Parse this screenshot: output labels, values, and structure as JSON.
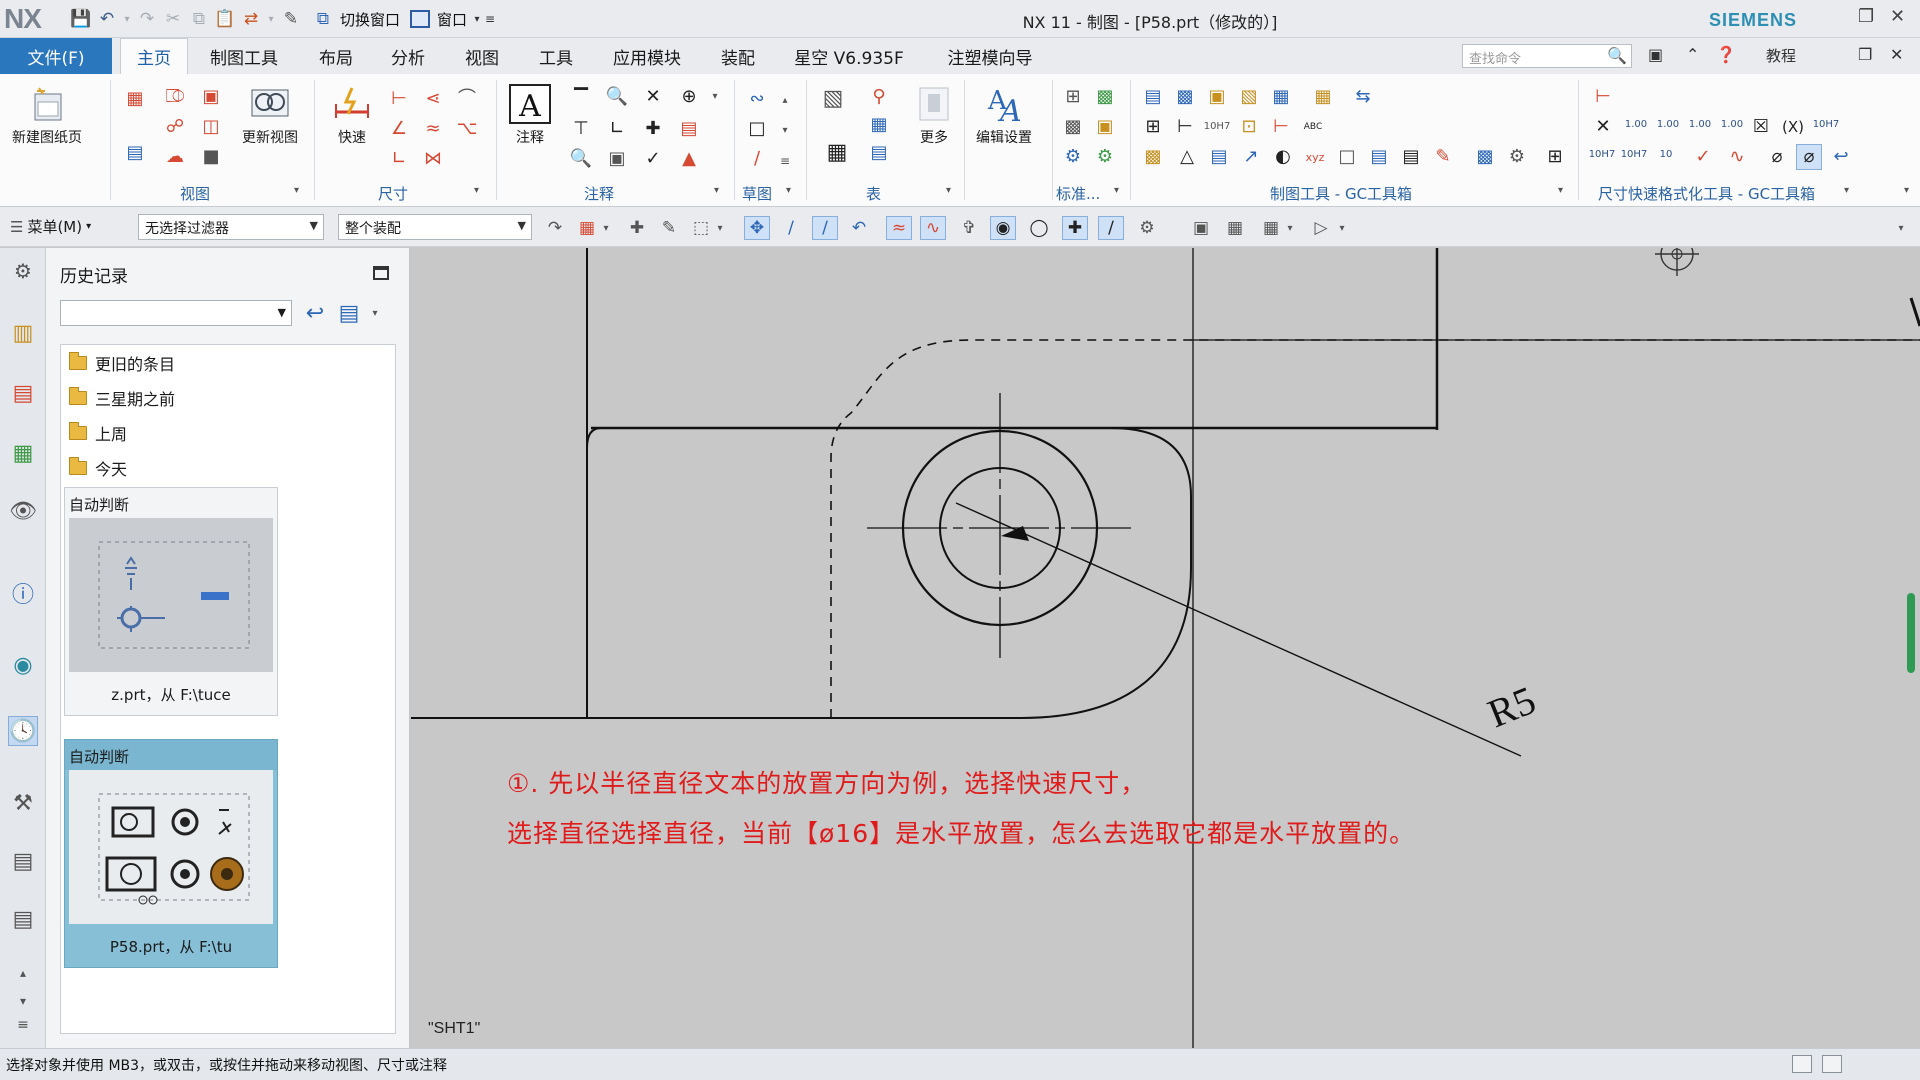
{
  "window": {
    "app_logo": "NX",
    "title": "NX 11 - 制图 - [P58.prt（修改的）]",
    "brand": "SIEMENS",
    "quick_access": {
      "switch_window": "切换窗口",
      "window_menu": "窗口"
    }
  },
  "ribbon_tabs": {
    "file": "文件(F)",
    "tabs": [
      "主页",
      "制图工具",
      "布局",
      "分析",
      "视图",
      "工具",
      "应用模块",
      "装配",
      "星空 V6.935F",
      "注塑模向导"
    ],
    "active_tab": "主页",
    "search_placeholder": "查找命令",
    "tutorial": "教程"
  },
  "ribbon": {
    "new_sheet": "新建图纸页",
    "update_view": "更新视图",
    "rapid": "快速",
    "note": "注释",
    "more": "更多",
    "edit_settings": "编辑设置",
    "groups": {
      "view": "视图",
      "dimension": "尺寸",
      "annotation": "注释",
      "sketch": "草图",
      "table": "表",
      "standard": "标准...",
      "drafting_tools": "制图工具 - GC工具箱",
      "dim_format": "尺寸快速格式化工具 - GC工具箱"
    },
    "tolerance_icons": [
      "1.00",
      "1.00",
      "1.00",
      "1.00",
      "10H7",
      "10H7",
      "10H7",
      "10"
    ]
  },
  "selection_bar": {
    "menu": "菜单(M)",
    "filter": "无选择过滤器",
    "scope": "整个装配"
  },
  "history_panel": {
    "title": "历史记录",
    "folders": [
      "更旧的条目",
      "三星期之前",
      "上周",
      "今天"
    ],
    "cards": [
      {
        "header": "自动判断",
        "name": "z.prt，从 F:\\tuce"
      },
      {
        "header": "自动判断",
        "name": "P58.prt，从 F:\\tu"
      }
    ]
  },
  "drawing": {
    "sheet_name": "\"SHT1\"",
    "radius_label": "R5"
  },
  "tutorial_note": {
    "line1": "①. 先以半径直径文本的放置方向为例，选择快速尺寸，",
    "line2": "选择直径选择直径，当前【ø16】是水平放置，怎么去选取它都是水平放置的。"
  },
  "status": {
    "message": "选择对象并使用 MB3，或双击，或按住并拖动来移动视图、尺寸或注释"
  },
  "colors": {
    "accent": "#2b77bd",
    "note_red": "#e01b1b",
    "canvas_bg": "#c8c8c8",
    "group_label": "#2a63a3"
  }
}
